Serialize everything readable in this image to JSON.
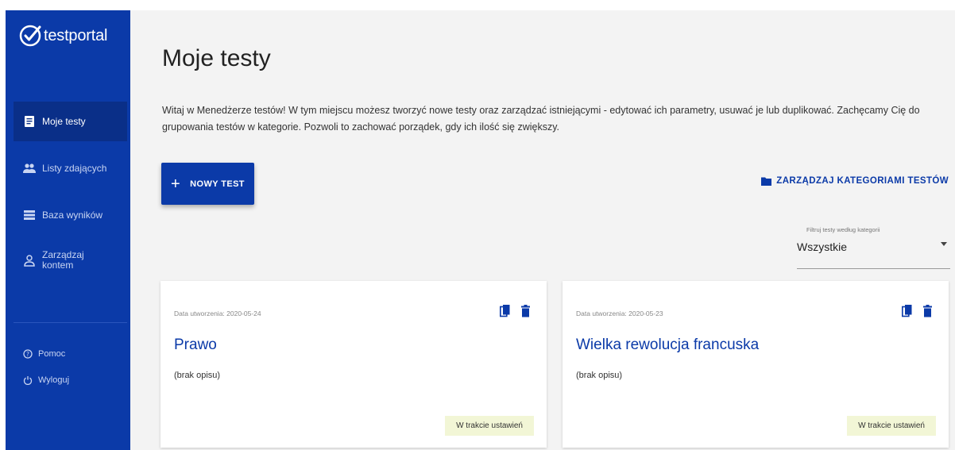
{
  "sidebar": {
    "brand": "testportal",
    "items": [
      {
        "label": "Moje testy",
        "icon": "document-icon",
        "active": true
      },
      {
        "label": "Listy zdających",
        "icon": "group-icon",
        "active": false
      },
      {
        "label": "Baza wyników",
        "icon": "list-icon",
        "active": false
      },
      {
        "label": "Zarządzaj kontem",
        "icon": "person-icon",
        "active": false
      }
    ],
    "footer": [
      {
        "label": "Pomoc",
        "icon": "help-icon"
      },
      {
        "label": "Wyloguj",
        "icon": "power-icon"
      }
    ]
  },
  "main": {
    "title": "Moje testy",
    "intro": "Witaj w Menedżerze testów! W tym miejscu możesz tworzyć nowe testy oraz zarządzać istniejącymi - edytować ich parametry, usuwać je lub duplikować. Zachęcamy Cię do grupowania testów w kategorie. Pozwoli to zachować porządek, gdy ich ilość się zwiększy.",
    "new_test_label": "NOWY TEST",
    "manage_categories_label": "ZARZĄDZAJ KATEGORIAMI TESTÓW",
    "filter": {
      "label": "Filtruj testy według kategorii",
      "value": "Wszystkie"
    },
    "cards": [
      {
        "date": "Data utworzenia: 2020-05-24",
        "title": "Prawo",
        "description": "(brak opisu)",
        "status": "W trakcie ustawień"
      },
      {
        "date": "Data utworzenia: 2020-05-23",
        "title": "Wielka rewolucja francuska",
        "description": "(brak opisu)",
        "status": "W trakcie ustawień"
      }
    ]
  },
  "colors": {
    "sidebar": "#0b3aa8",
    "sidebar_active": "#0a2f88",
    "accent": "#0b3aa8",
    "background": "#f3f3f3",
    "status_badge": "#f2f6d6"
  }
}
